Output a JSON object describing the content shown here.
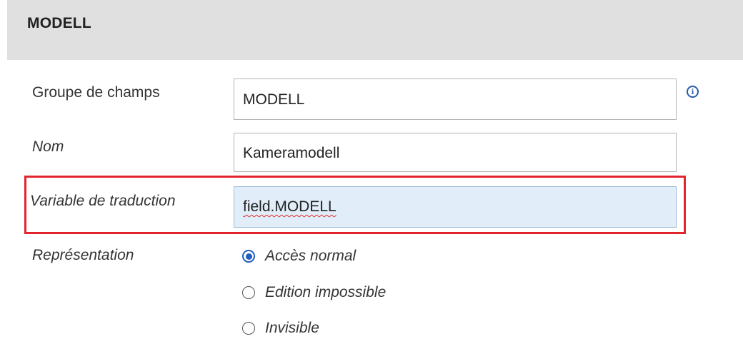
{
  "section": {
    "title": "MODELL"
  },
  "fields": {
    "field_group": {
      "label": "Groupe de champs",
      "value": "MODELL"
    },
    "name": {
      "label": "Nom",
      "value": "Kameramodell"
    },
    "translation_variable": {
      "label": "Variable de traduction",
      "value": "field.MODELL"
    },
    "representation": {
      "label": "Représentation",
      "options": [
        {
          "label": "Accès normal",
          "checked": true
        },
        {
          "label": "Edition impossible",
          "checked": false
        },
        {
          "label": "Invisible",
          "checked": false
        }
      ]
    }
  },
  "icons": {
    "info": "info-icon"
  },
  "colors": {
    "header_bg": "#e0e0e0",
    "highlight": "#e2252d",
    "focused_input_bg": "#e1edf8",
    "radio_accent": "#1f5fbf",
    "info_icon": "#2b5aa8"
  }
}
